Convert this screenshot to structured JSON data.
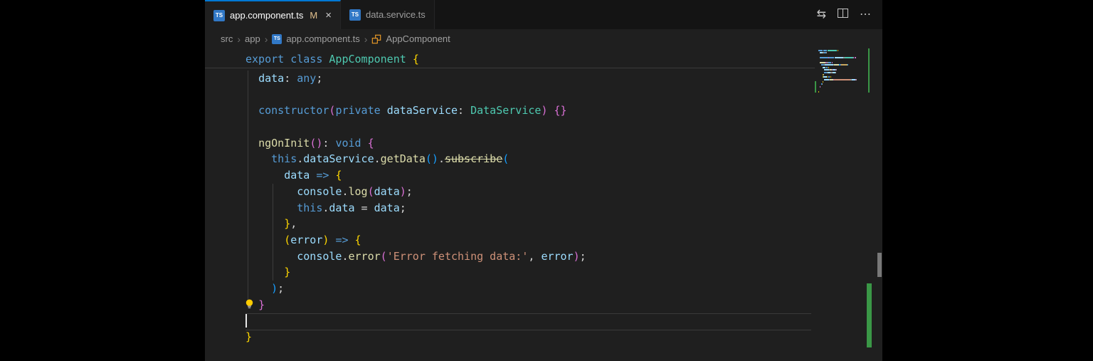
{
  "tab_bar": {
    "file_icon_label": "TS",
    "close_glyph": "×",
    "tabs": [
      {
        "label": "app.component.ts",
        "modified_badge": "M",
        "active": true
      },
      {
        "label": "data.service.ts",
        "active": false
      }
    ],
    "actions": {
      "open_changes": "⇆",
      "more": "⋯"
    }
  },
  "breadcrumb": {
    "separator": "›",
    "items": [
      "src",
      "app",
      "app.component.ts",
      "AppComponent"
    ]
  },
  "editor": {
    "sticky_line": [
      [
        "export",
        "kw"
      ],
      [
        " ",
        "pl"
      ],
      [
        "class",
        "kw"
      ],
      [
        " ",
        "pl"
      ],
      [
        "AppComponent",
        "cls"
      ],
      [
        " ",
        "pl"
      ],
      [
        "{",
        "b1"
      ]
    ],
    "lines": [
      [
        [
          "  ",
          "pl"
        ],
        [
          "data",
          "var"
        ],
        [
          ": ",
          "pl"
        ],
        [
          "any",
          "kw"
        ],
        [
          ";",
          "pl"
        ]
      ],
      [],
      [
        [
          "  ",
          "pl"
        ],
        [
          "constructor",
          "kw"
        ],
        [
          "(",
          "b2"
        ],
        [
          "private",
          "kw"
        ],
        [
          " ",
          "pl"
        ],
        [
          "dataService",
          "var"
        ],
        [
          ": ",
          "pl"
        ],
        [
          "DataService",
          "cls"
        ],
        [
          ")",
          "b2"
        ],
        [
          " ",
          "pl"
        ],
        [
          "{}",
          "b2"
        ]
      ],
      [],
      [
        [
          "  ",
          "pl"
        ],
        [
          "ngOnInit",
          "fn"
        ],
        [
          "(",
          "b2"
        ],
        [
          ")",
          "b2"
        ],
        [
          ": ",
          "pl"
        ],
        [
          "void",
          "kw"
        ],
        [
          " ",
          "pl"
        ],
        [
          "{",
          "b2"
        ]
      ],
      [
        [
          "    ",
          "pl"
        ],
        [
          "this",
          "kw"
        ],
        [
          ".",
          "pl"
        ],
        [
          "dataService",
          "var"
        ],
        [
          ".",
          "pl"
        ],
        [
          "getData",
          "fn"
        ],
        [
          "(",
          "b3"
        ],
        [
          ")",
          "b3"
        ],
        [
          ".",
          "pl"
        ],
        [
          "subscribe",
          "dep"
        ],
        [
          "(",
          "b3"
        ]
      ],
      [
        [
          "      ",
          "pl"
        ],
        [
          "data",
          "var"
        ],
        [
          " ",
          "pl"
        ],
        [
          "=>",
          "kw"
        ],
        [
          " ",
          "pl"
        ],
        [
          "{",
          "b1"
        ]
      ],
      [
        [
          "        ",
          "pl"
        ],
        [
          "console",
          "var"
        ],
        [
          ".",
          "pl"
        ],
        [
          "log",
          "fn"
        ],
        [
          "(",
          "b2"
        ],
        [
          "data",
          "var"
        ],
        [
          ")",
          "b2"
        ],
        [
          ";",
          "pl"
        ]
      ],
      [
        [
          "        ",
          "pl"
        ],
        [
          "this",
          "kw"
        ],
        [
          ".",
          "pl"
        ],
        [
          "data",
          "var"
        ],
        [
          " = ",
          "pl"
        ],
        [
          "data",
          "var"
        ],
        [
          ";",
          "pl"
        ]
      ],
      [
        [
          "      ",
          "pl"
        ],
        [
          "}",
          "b1"
        ],
        [
          ",",
          "pl"
        ]
      ],
      [
        [
          "      ",
          "pl"
        ],
        [
          "(",
          "b1"
        ],
        [
          "error",
          "var"
        ],
        [
          ")",
          "b1"
        ],
        [
          " ",
          "pl"
        ],
        [
          "=>",
          "kw"
        ],
        [
          " ",
          "pl"
        ],
        [
          "{",
          "b1"
        ]
      ],
      [
        [
          "        ",
          "pl"
        ],
        [
          "console",
          "var"
        ],
        [
          ".",
          "pl"
        ],
        [
          "error",
          "fn"
        ],
        [
          "(",
          "b2"
        ],
        [
          "'Error fetching data:'",
          "str"
        ],
        [
          ", ",
          "pl"
        ],
        [
          "error",
          "var"
        ],
        [
          ")",
          "b2"
        ],
        [
          ";",
          "pl"
        ]
      ],
      [
        [
          "      ",
          "pl"
        ],
        [
          "}",
          "b1"
        ]
      ],
      [
        [
          "    ",
          "pl"
        ],
        [
          ")",
          "b3"
        ],
        [
          ";",
          "pl"
        ]
      ],
      [
        [
          "  ",
          "pl"
        ],
        [
          "}",
          "b2"
        ]
      ],
      [],
      [
        [
          "}",
          "b1"
        ]
      ]
    ],
    "cursor": {
      "line_index": 15,
      "col": 0
    },
    "lightbulb_line_index": 14
  },
  "colors": {
    "accent_blue": "#0078d4",
    "editor_background": "#1f1f1f",
    "tab_bar_background": "#181818",
    "git_added_green": "#3a9746",
    "modified_badge": "#e2c08d",
    "typescript_icon_blue": "#3178c6"
  }
}
